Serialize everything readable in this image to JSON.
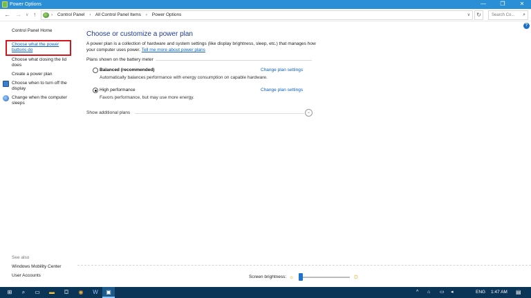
{
  "window": {
    "title": "Power Options",
    "minimize_glyph": "—",
    "maximize_glyph": "❐",
    "close_glyph": "✕"
  },
  "address": {
    "back_glyph": "←",
    "forward_glyph": "→",
    "recent_glyph": "∨",
    "up_glyph": "↑",
    "icon": "control-panel-icon",
    "crumbs": [
      "Control Panel",
      "All Control Panel Items",
      "Power Options"
    ],
    "separator": "›",
    "dropdown_glyph": "∨",
    "refresh_glyph": "↻",
    "search_placeholder": "Search Co...",
    "search_glyph": "⌕"
  },
  "help": {
    "glyph": "?"
  },
  "sidebar": {
    "home_label": "Control Panel Home",
    "links": [
      "Choose what the power buttons do",
      "Choose what closing the lid does",
      "Create a power plan",
      "Choose when to turn off the display",
      "Change when the computer sleeps"
    ],
    "see_also_label": "See also",
    "see_also_links": [
      "Windows Mobility Center",
      "User Accounts"
    ],
    "highlight_color": "#d3151f"
  },
  "main": {
    "heading": "Choose or customize a power plan",
    "intro": "A power plan is a collection of hardware and system settings (like display brightness, sleep, etc.) that manages how your computer uses power.",
    "intro_link": "Tell me more about power plans",
    "section_label": "Plans shown on the battery meter",
    "plans": [
      {
        "name": "Balanced (recommended)",
        "description": "Automatically balances performance with energy consumption on capable hardware.",
        "link": "Change plan settings",
        "selected": false
      },
      {
        "name": "High performance",
        "description": "Favors performance, but may use more energy.",
        "link": "Change plan settings",
        "selected": true
      }
    ],
    "show_more_label": "Show additional plans",
    "show_more_glyph": "⌄"
  },
  "brightness": {
    "label": "Screen brightness:",
    "level": 0.0,
    "sun_glyph": "☼"
  },
  "taskbar": {
    "start_glyph": "⊞",
    "search_glyph": "⌕",
    "taskview_glyph": "▭",
    "files_glyph": "▬",
    "store_glyph": "⛋",
    "chrome_glyph": "◉",
    "word_glyph": "W",
    "power_glyph": "▣",
    "tray_up_glyph": "^",
    "network_glyph": "⌂",
    "battery_glyph": "▭",
    "volume_glyph": "◂",
    "language": "ENG",
    "time": "1:47 AM",
    "notification_glyph": "▤",
    "accent": "#0b3557"
  }
}
